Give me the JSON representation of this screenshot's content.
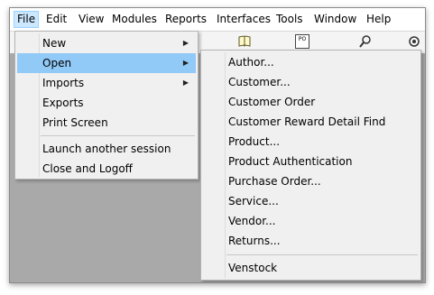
{
  "menubar": {
    "items": [
      {
        "label": "File"
      },
      {
        "label": "Edit"
      },
      {
        "label": "View"
      },
      {
        "label": "Modules"
      },
      {
        "label": "Reports"
      },
      {
        "label": "Interfaces"
      },
      {
        "label": "Tools"
      },
      {
        "label": "Window"
      },
      {
        "label": "Help"
      }
    ],
    "active_item": "File"
  },
  "toolbar": {
    "icons": [
      "book-icon",
      "purchase-order-icon",
      "search-icon",
      "settings-icon"
    ],
    "po_icon_text": "PO"
  },
  "file_menu": {
    "items": [
      {
        "label": "New",
        "has_submenu": true
      },
      {
        "label": "Open",
        "has_submenu": true,
        "highlighted": true
      },
      {
        "label": "Imports",
        "has_submenu": true
      },
      {
        "label": "Exports",
        "has_submenu": false
      },
      {
        "label": "Print Screen",
        "has_submenu": false
      },
      {
        "label": "Launch another session",
        "has_submenu": false
      },
      {
        "label": "Close and Logoff",
        "has_submenu": false
      }
    ],
    "submenu_arrow": "▶"
  },
  "open_submenu": {
    "items": [
      {
        "label": "Author..."
      },
      {
        "label": "Customer..."
      },
      {
        "label": "Customer Order"
      },
      {
        "label": "Customer Reward Detail Find"
      },
      {
        "label": "Product..."
      },
      {
        "label": "Product Authentication"
      },
      {
        "label": "Purchase Order..."
      },
      {
        "label": "Service..."
      },
      {
        "label": "Vendor..."
      },
      {
        "label": "Returns..."
      },
      {
        "label": "Venstock"
      }
    ]
  },
  "colors": {
    "highlight": "#91c9f7",
    "menu_background": "#f0f0f0",
    "workspace": "#a9a9a9",
    "active_menubar_item": "#cce8ff"
  }
}
